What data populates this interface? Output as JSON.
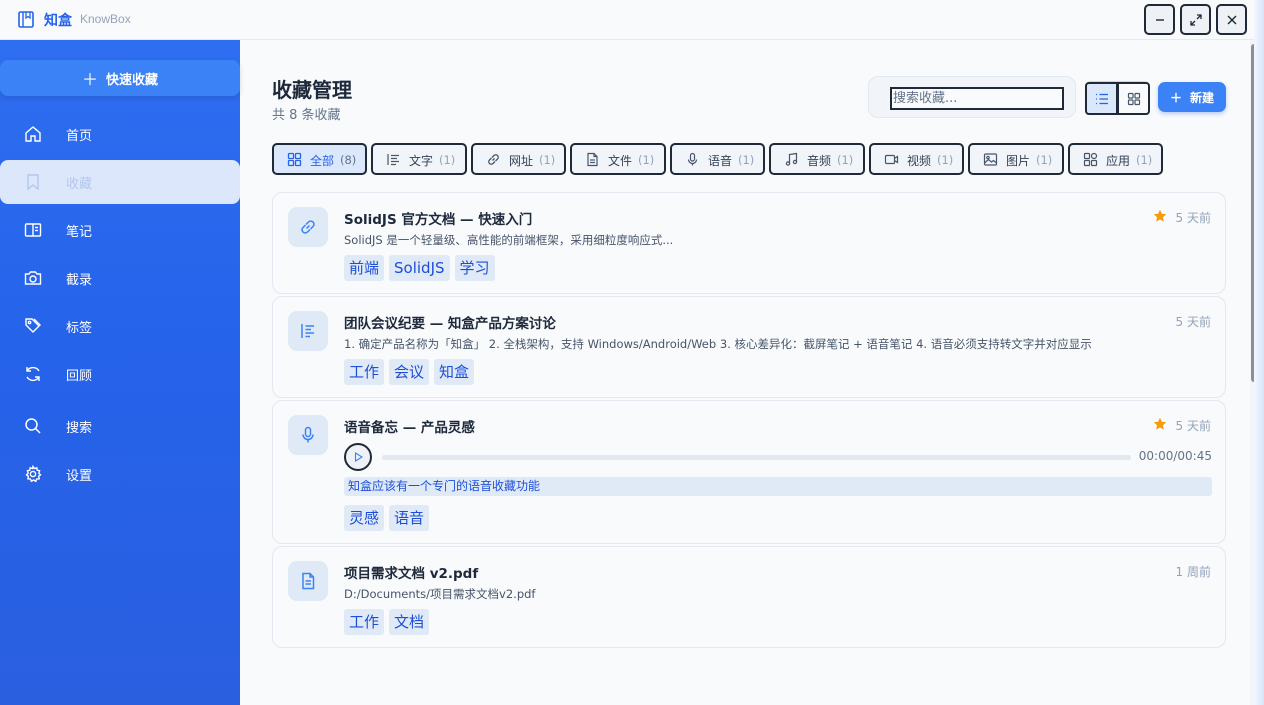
{
  "app": {
    "name": "知盒",
    "subtitle": "KnowBox"
  },
  "window_controls": {
    "minimize": "minimize",
    "maximize": "maximize",
    "close": "close"
  },
  "sidebar": {
    "quick_add": "快速收藏",
    "items": [
      {
        "label": "首页",
        "icon": "home-icon"
      },
      {
        "label": "收藏",
        "icon": "bookmark-icon",
        "active": true
      },
      {
        "label": "笔记",
        "icon": "book-open-icon"
      },
      {
        "label": "截录",
        "icon": "camera-icon"
      },
      {
        "label": "标签",
        "icon": "tags-icon"
      },
      {
        "label": "回顾",
        "icon": "refresh-icon"
      },
      {
        "label": "搜索",
        "icon": "search-icon"
      },
      {
        "label": "设置",
        "icon": "gear-icon"
      }
    ]
  },
  "main": {
    "title": "收藏管理",
    "count_text": "共 8 条收藏",
    "search_placeholder": "搜索收藏...",
    "new_button": "新建",
    "filters": [
      {
        "label": "全部",
        "count": "(8)",
        "icon": "grid-icon",
        "active": true
      },
      {
        "label": "文字",
        "count": "(1)",
        "icon": "text-icon"
      },
      {
        "label": "网址",
        "count": "(1)",
        "icon": "link-icon"
      },
      {
        "label": "文件",
        "count": "(1)",
        "icon": "file-icon"
      },
      {
        "label": "语音",
        "count": "(1)",
        "icon": "mic-icon"
      },
      {
        "label": "音频",
        "count": "(1)",
        "icon": "music-icon"
      },
      {
        "label": "视频",
        "count": "(1)",
        "icon": "video-icon"
      },
      {
        "label": "图片",
        "count": "(1)",
        "icon": "image-icon"
      },
      {
        "label": "应用",
        "count": "(1)",
        "icon": "apps-icon"
      }
    ],
    "cards": [
      {
        "type_icon": "link-icon",
        "title": "SolidJS 官方文档 — 快速入门",
        "desc": "SolidJS 是一个轻量级、高性能的前端框架，采用细粒度响应式...",
        "time": "5 天前",
        "starred": true,
        "tags": [
          "前端",
          "SolidJS",
          "学习"
        ]
      },
      {
        "type_icon": "text-icon",
        "title": "团队会议纪要 — 知盒产品方案讨论",
        "desc": "1. 确定产品名称为「知盒」 2. 全栈架构，支持 Windows/Android/Web 3. 核心差异化：截屏笔记 + 语音笔记 4. 语音必须支持转文字并对应显示",
        "time": "5 天前",
        "starred": false,
        "tags": [
          "工作",
          "会议",
          "知盒"
        ]
      },
      {
        "type_icon": "mic-icon",
        "title": "语音备忘 — 产品灵感",
        "time": "5 天前",
        "starred": true,
        "player_time": "00:00/00:45",
        "progress": 0,
        "transcript": "知盒应该有一个专门的语音收藏功能",
        "tags": [
          "灵感",
          "语音"
        ]
      },
      {
        "type_icon": "file-icon",
        "title": "项目需求文档 v2.pdf",
        "desc": "D:/Documents/项目需求文档v2.pdf",
        "time": "1 周前",
        "starred": false,
        "tags": [
          "工作",
          "文档"
        ]
      }
    ]
  },
  "colors": {
    "accent": "#2563eb",
    "star": "#f59e0b",
    "tag_bg": "#e0eaf7"
  }
}
